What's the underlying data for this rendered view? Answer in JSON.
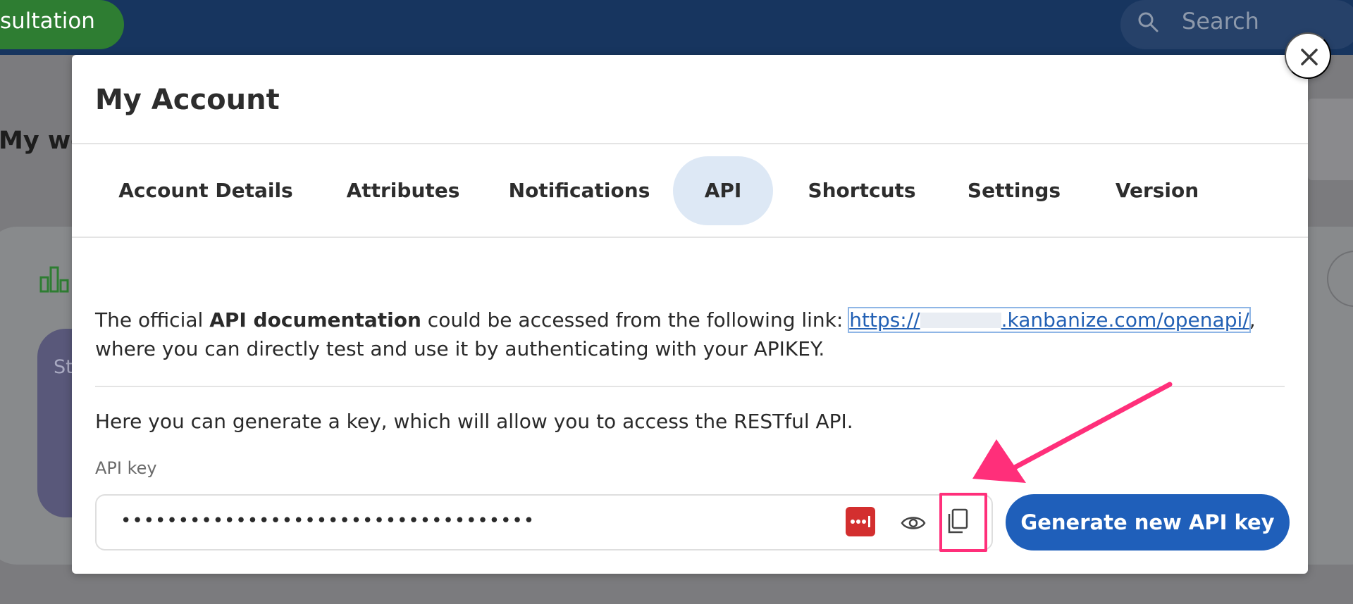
{
  "background": {
    "consult_label": "sultation",
    "search_placeholder": "Search",
    "page_title": "My wo",
    "tile_text": "St"
  },
  "modal": {
    "title": "My Account",
    "tabs": [
      {
        "label": "Account Details",
        "active": false
      },
      {
        "label": "Attributes",
        "active": false
      },
      {
        "label": "Notifications",
        "active": false
      },
      {
        "label": "API",
        "active": true
      },
      {
        "label": "Shortcuts",
        "active": false
      },
      {
        "label": "Settings",
        "active": false
      },
      {
        "label": "Version",
        "active": false
      }
    ],
    "doc": {
      "prefix": "The official ",
      "bold": "API documentation",
      "middle": " could be accessed from the following link: ",
      "link_start": "https://",
      "link_end": ".kanbanize.com/openapi/",
      "suffix": ", where you can directly test and use it by authenticating with your APIKEY."
    },
    "generate_text": "Here you can generate a key, which will allow you to access the RESTful API.",
    "api_key_label": "API key",
    "api_key_value": "••••••••••••••••••••••••••••••••••••",
    "generate_button": "Generate new API key"
  },
  "colors": {
    "topbar": "#17355f",
    "consult_green": "#2e7d32",
    "active_tab_bg": "#dde8f5",
    "link": "#2260b4",
    "primary_button": "#1f5fba",
    "password_manager_red": "#d32f2f",
    "annotation_pink": "#ff2f7a"
  },
  "icons": [
    "search-icon",
    "bar-chart-icon",
    "close-icon",
    "password-manager-icon",
    "eye-icon",
    "copy-icon",
    "annotation-arrow-icon"
  ]
}
